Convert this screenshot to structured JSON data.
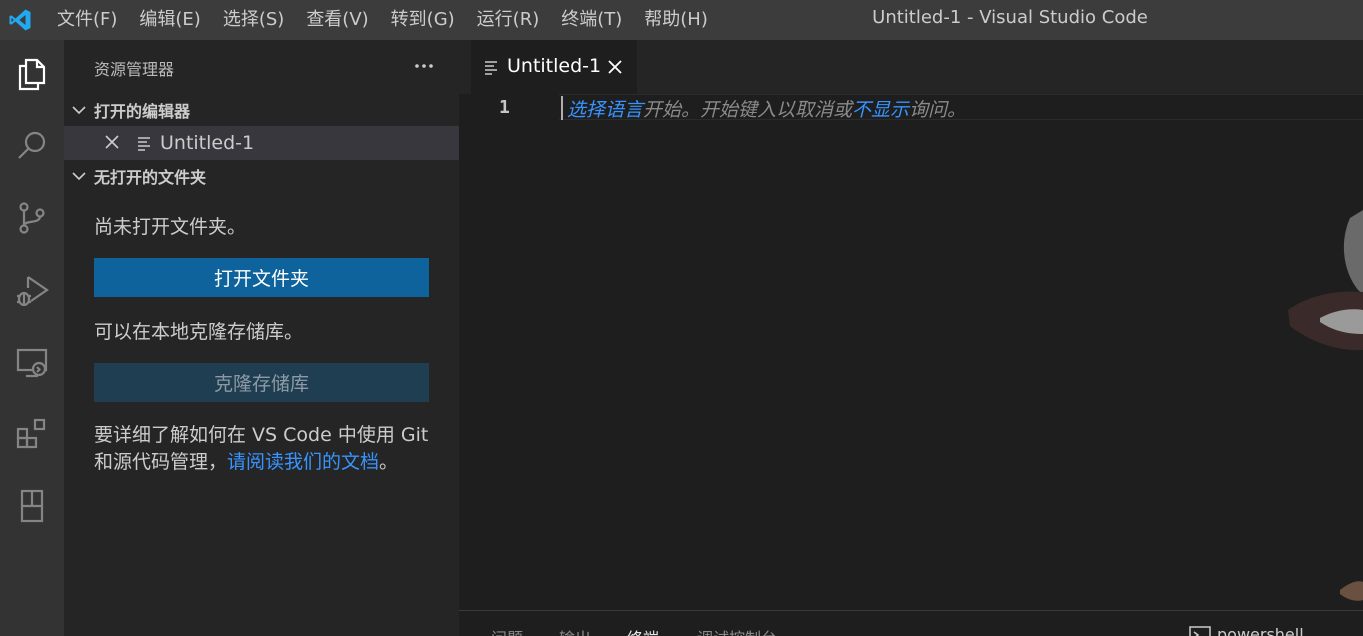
{
  "window": {
    "title": "Untitled-1 - Visual Studio Code",
    "menu": [
      "文件(F)",
      "编辑(E)",
      "选择(S)",
      "查看(V)",
      "转到(G)",
      "运行(R)",
      "终端(T)",
      "帮助(H)"
    ]
  },
  "activity_bar": {
    "items": [
      "explorer-icon",
      "search-icon",
      "source-control-icon",
      "run-debug-icon",
      "remote-explorer-icon",
      "extensions-icon",
      "book-icon"
    ]
  },
  "sidebar": {
    "title": "资源管理器",
    "open_editors": {
      "header": "打开的编辑器",
      "files": [
        "Untitled-1"
      ]
    },
    "no_folder": {
      "header": "无打开的文件夹",
      "message": "尚未打开文件夹。",
      "open_button": "打开文件夹",
      "clone_message": "可以在本地克隆存储库。",
      "clone_button": "克隆存储库",
      "learn_line1": "要详细了解如何在 VS Code 中使用 Git",
      "learn_line2_prefix": "和源代码管理，",
      "learn_link": "请阅读我们的文档",
      "learn_suffix": "。"
    }
  },
  "editor": {
    "tab_label": "Untitled-1",
    "line_number": "1",
    "hint": {
      "link1": "选择语言",
      "text1": "开始。开始键入以取消或",
      "link2": "不显示",
      "text2": "询问。"
    }
  },
  "panel": {
    "tabs": [
      "问题",
      "输出",
      "终端",
      "调试控制台"
    ],
    "active_tab": "终端",
    "terminal": "powershell"
  },
  "colors": {
    "accent": "#0e639c",
    "link": "#3794ff",
    "vscode_blue": "#23a9f2"
  }
}
